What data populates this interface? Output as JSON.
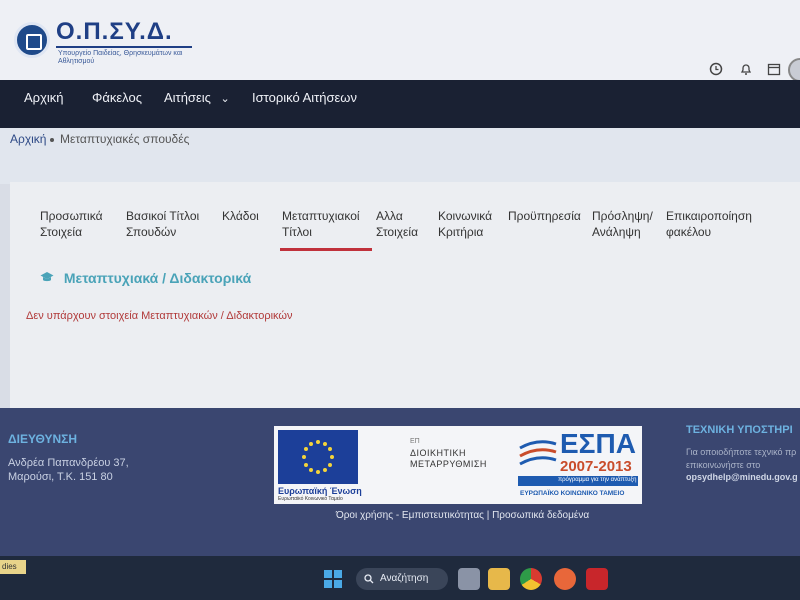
{
  "header": {
    "logo_title": "Ο.Π.ΣΥ.Δ.",
    "logo_subtitle": "Υπουργείο Παιδείας, Θρησκευμάτων και Αθλητισμού",
    "icons": [
      "clock-icon",
      "bell-icon",
      "calendar-icon",
      "avatar"
    ]
  },
  "nav": {
    "items": [
      "Αρχική",
      "Φάκελος",
      "Αιτήσεις",
      "Ιστορικό Αιτήσεων"
    ],
    "dropdown_caret": "⌄"
  },
  "breadcrumb": [
    "Αρχική",
    "Μεταπτυχιακές σπουδές"
  ],
  "tabs": [
    {
      "label": "Προσωπικά Στοιχεία"
    },
    {
      "label": "Βασικοί Τίτλοι Σπουδών"
    },
    {
      "label": "Κλάδοι"
    },
    {
      "label": "Μεταπτυχιακοί Τίτλοι",
      "active": true
    },
    {
      "label": "Αλλα Στοιχεία"
    },
    {
      "label": "Κοινωνικά Κριτήρια"
    },
    {
      "label": "Προϋπηρεσία"
    },
    {
      "label": "Πρόσληψη/ Ανάληψη"
    },
    {
      "label": "Επικαιροποίηση φακέλου"
    }
  ],
  "section": {
    "title": "Μεταπτυχιακά / Διδακτορικά",
    "empty_message": "Δεν υπάρχουν στοιχεία Μεταπτυχιακών / Διδακτορικών"
  },
  "footer": {
    "address_title": "ΔΙΕΥΘΥΝΣΗ",
    "address_line1": "Ανδρέα Παπανδρέου 37,",
    "address_line2": "Μαρούσι, Τ.Κ. 151 80",
    "eu_label": "Ευρωπαϊκή Ένωση",
    "eu_sub": "Ευρωπαϊκό Κοινωνικό Ταμείο",
    "dm_ep": "ΕΠ",
    "dm_line1": "ΔΙΟΙΚΗΤΙΚΗ",
    "dm_line2": "ΜΕΤΑΡΡΥΘΜΙΣΗ",
    "espa_title": "ΕΣΠΑ",
    "espa_years": "2007-2013",
    "espa_slogan": "πρόγραμμα για την ανάπτυξη",
    "espa_fund": "ΕΥΡΩΠΑΪΚΟ ΚΟΙΝΩΝΙΚΟ ΤΑΜΕΙΟ",
    "links": "Όροι χρήσης - Εμπιστευτικότητας | Προσωπικά δεδομένα",
    "support_title": "ΤΕΧΝΙΚΗ ΥΠΟΣΤΗΡΙ",
    "support_text1": "Για οποιοδήποτε τεχνικό πρ",
    "support_text2": "επικοινωνήστε στο",
    "support_email": "opsydhelp@minedu.gov.g"
  },
  "taskbar": {
    "stub_label": "dies",
    "search_label": "Αναζήτηση"
  },
  "colors": {
    "navbar": "#1a2133",
    "footer": "#3a4670",
    "accent_teal": "#4aa3b8",
    "active_tab_underline": "#c0313b",
    "empty_message": "#b13a3a"
  }
}
